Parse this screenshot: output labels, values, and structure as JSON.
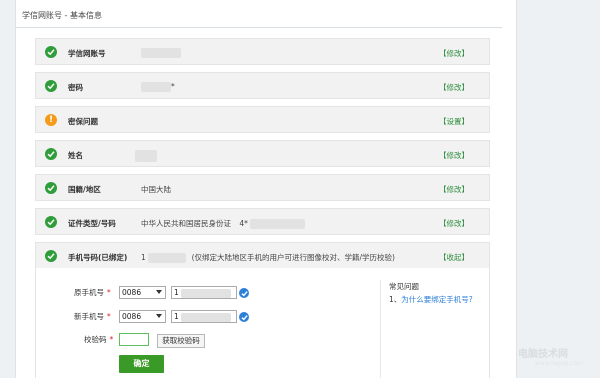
{
  "page": {
    "title": "学信网账号 - 基本信息"
  },
  "rows": [
    {
      "label": "学信网账号",
      "value": "",
      "action": "【修改】",
      "status": "ok"
    },
    {
      "label": "密码",
      "value": "*",
      "action": "【修改】",
      "status": "ok"
    },
    {
      "label": "密保问题",
      "value": "",
      "action": "【设置】",
      "status": "warn"
    },
    {
      "label": "姓名",
      "value": "",
      "action": "【修改】",
      "status": "ok"
    },
    {
      "label": "国籍/地区",
      "value": "中国大陆",
      "action": "【修改】",
      "status": "ok"
    },
    {
      "label": "证件类型/号码",
      "value": "中华人民共和国居民身份证",
      "value2": "4*",
      "action": "【修改】",
      "status": "ok"
    },
    {
      "label": "手机号码(已绑定)",
      "value": "1",
      "note": "(仅绑定大陆地区手机的用户可进行图像校对、学籍/学历校验)",
      "action": "【收起】",
      "status": "ok"
    }
  ],
  "form": {
    "old_phone": {
      "label": "原手机号",
      "required": "*",
      "country_code": "0086",
      "number_prefix": "1"
    },
    "new_phone": {
      "label": "新手机号",
      "required": "*",
      "country_code": "0086",
      "number_prefix": "1"
    },
    "code": {
      "label": "校验码",
      "required": "*",
      "value": "",
      "get_code_label": "获取校验码"
    },
    "confirm_label": "确定"
  },
  "faq": {
    "title": "常见问题",
    "items": [
      {
        "num": "1、",
        "text": "为什么要绑定手机号?"
      }
    ]
  },
  "watermark": {
    "text": "电脑技术网",
    "sub": "www.tagxp.com"
  },
  "colors": {
    "green_action": "#2d8c3c",
    "ok_icon": "#2f9e3a",
    "warn_icon": "#f59b1b",
    "confirm_button": "#3a9a27",
    "link_blue": "#2d7fd8"
  }
}
